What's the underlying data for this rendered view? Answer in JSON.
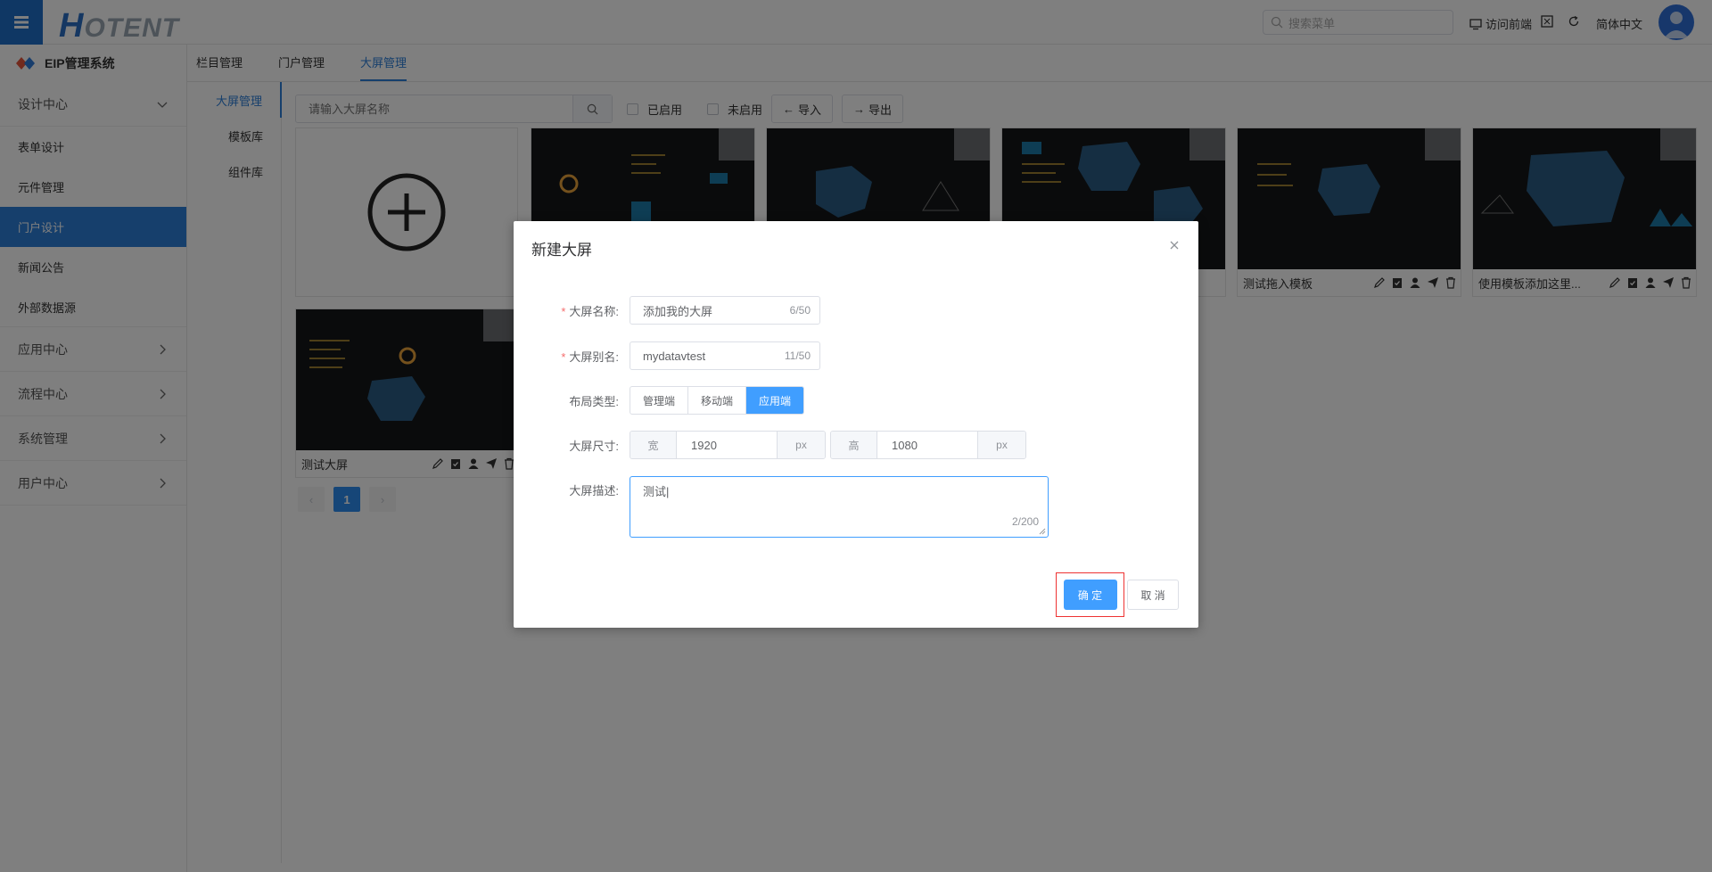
{
  "header": {
    "logo_h": "H",
    "logo_rest": "OTENT",
    "search_placeholder": "搜索菜单",
    "visit_front": "访问前端",
    "language": "简体中文"
  },
  "sidebar": {
    "system_title": "EIP管理系统",
    "groups": [
      {
        "label": "设计中心"
      },
      {
        "label": "应用中心"
      },
      {
        "label": "流程中心"
      },
      {
        "label": "系统管理"
      },
      {
        "label": "用户中心"
      }
    ],
    "items": [
      {
        "label": "表单设计"
      },
      {
        "label": "元件管理"
      },
      {
        "label": "门户设计"
      },
      {
        "label": "新闻公告"
      },
      {
        "label": "外部数据源"
      }
    ]
  },
  "top_tabs": [
    {
      "label": "栏目管理"
    },
    {
      "label": "门户管理"
    },
    {
      "label": "大屏管理"
    }
  ],
  "subnav": [
    {
      "label": "大屏管理"
    },
    {
      "label": "模板库"
    },
    {
      "label": "组件库"
    }
  ],
  "toolbar": {
    "search_placeholder": "请输入大屏名称",
    "enabled_label": "已启用",
    "disabled_label": "未启用",
    "import_label": "导入",
    "export_label": "导出"
  },
  "cards": [
    {
      "title": ""
    },
    {
      "title": ""
    },
    {
      "title": ""
    },
    {
      "title": "测试拖入模板"
    },
    {
      "title": "使用模板添加这里..."
    },
    {
      "title": "测试大屏"
    }
  ],
  "pagination": {
    "prev": "‹",
    "current": "1",
    "next": "›"
  },
  "dialog": {
    "title": "新建大屏",
    "close": "×",
    "name_label": "大屏名称:",
    "name_value": "添加我的大屏",
    "name_count": "6/50",
    "alias_label": "大屏别名:",
    "alias_value": "mydatavtest",
    "alias_count": "11/50",
    "layout_label": "布局类型:",
    "layout_options": [
      "管理端",
      "移动端",
      "应用端"
    ],
    "layout_selected": "应用端",
    "size_label": "大屏尺寸:",
    "width_prefix": "宽",
    "width_value": "1920",
    "width_unit": "px",
    "height_prefix": "高",
    "height_value": "1080",
    "height_unit": "px",
    "desc_label": "大屏描述:",
    "desc_value": "测试|",
    "desc_count": "2/200",
    "ok_label": "确 定",
    "cancel_label": "取 消"
  },
  "colors": {
    "primary": "#409eff",
    "sidebar_active": "#2d7fd9",
    "required": "#f56c6c",
    "highlight_border": "#e33"
  }
}
